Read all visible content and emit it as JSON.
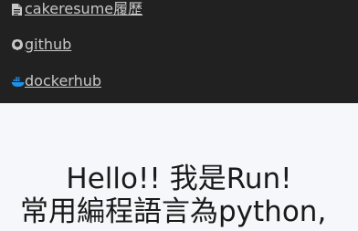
{
  "nav": {
    "links": [
      {
        "label": "cakeresume履歷",
        "icon": "document-icon"
      },
      {
        "label": "github",
        "icon": "github-icon"
      },
      {
        "label": " dockerhub",
        "icon": "docker-icon"
      }
    ]
  },
  "hero": {
    "line1": "Hello!! 我是Run!",
    "line2": "常用編程語言為python,"
  },
  "colors": {
    "nav_bg": "#212121",
    "nav_text": "#c7c7c7",
    "page_bg": "#f5f7fa",
    "docker_blue": "#1d91e6"
  }
}
